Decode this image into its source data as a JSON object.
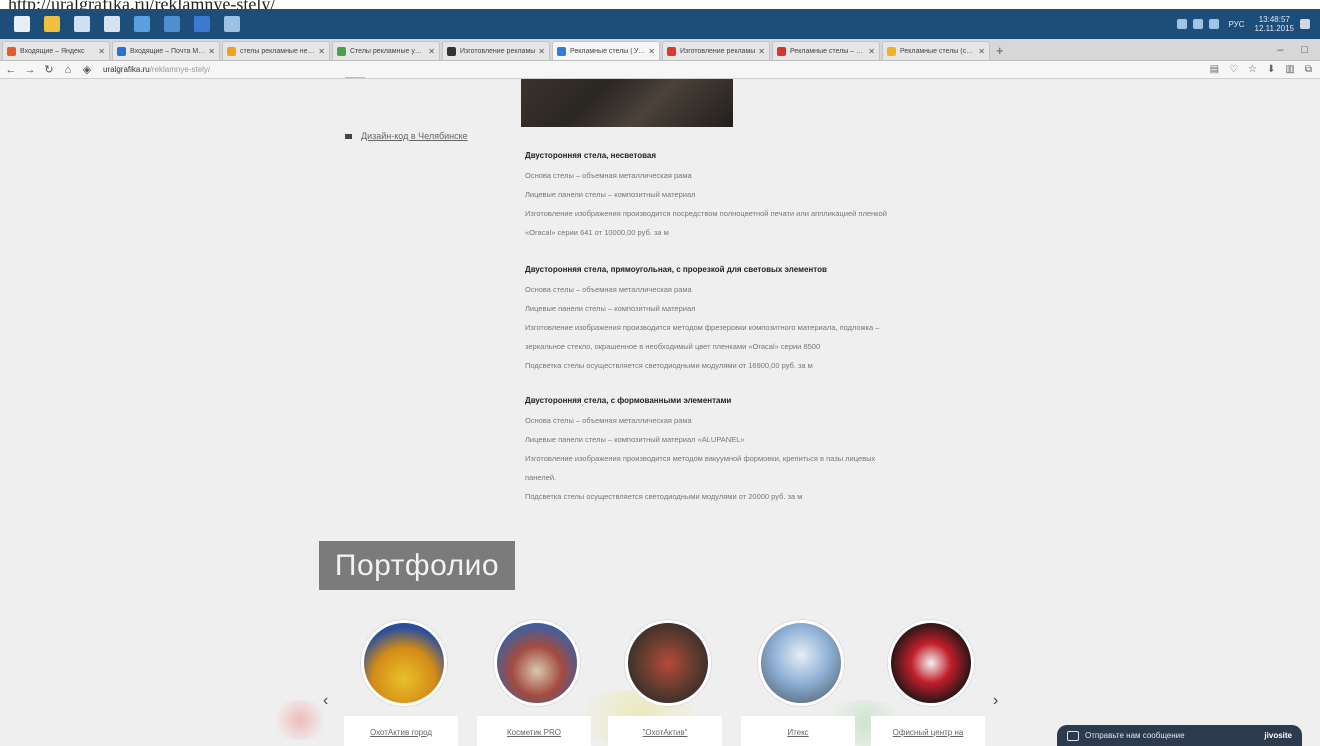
{
  "url_strip": {
    "text": "http://uralgrafika.ru/reklamnye-stely/"
  },
  "taskbar": {
    "clock_time": "13:48:57",
    "clock_date": "12.11.2015",
    "lang": "РУС"
  },
  "tabs": [
    {
      "label": "Входящие – Яндекс",
      "color": "#e55a2b"
    },
    {
      "label": "Входящие – Почта Mail.ru",
      "color": "#2a6fd1"
    },
    {
      "label": "стелы рекламные несветовые",
      "color": "#f1a21a"
    },
    {
      "label": "Стелы рекламные уличные",
      "color": "#4aa04a"
    },
    {
      "label": "Изготовление рекламы",
      "color": "#333333"
    },
    {
      "label": "Рекламные стелы | Уралграфика",
      "color": "#2b7fd8",
      "active": true
    },
    {
      "label": "Изготовление рекламы",
      "color": "#d93a2b"
    },
    {
      "label": "Рекламные стелы – Екатеринбург",
      "color": "#d9342b"
    },
    {
      "label": "Рекламные стелы (стелы)",
      "color": "#f2b41c"
    }
  ],
  "browser": {
    "url_domain": "uralgrafika.ru",
    "url_path": "/reklamnye-stely/"
  },
  "sidebar": {
    "link": "Дизайн-код в Челябинске"
  },
  "sections": [
    {
      "title": "Двусторонняя стела, несветовая",
      "lines": [
        "Основа стелы – объемная металлическая рама",
        "Лицевые панели стелы – композитный материал",
        "Изготовление изображения производится посредством полноцветной печати или аппликацией пленкой",
        "«Oracal» серии 641 от 10000,00 руб. за м"
      ]
    },
    {
      "title": "Двусторонняя стела, прямоугольная, с прорезкой для световых элементов",
      "lines": [
        "Основа стелы – объемная металлическая рама",
        "Лицевые панели стелы – композитный материал",
        "Изготовление изображения производится методом фрезеровки композитного материала, подложка –",
        "зеркальное стекло, окрашенное в необходимый цвет пленками «Oracal» серии 8500",
        "Подсветка стелы осуществляется светодиодными модулями от 16900,00 руб. за м"
      ]
    },
    {
      "title": "Двусторонняя стела, с формованными элементами",
      "lines": [
        "Основа стелы – объемная металлическая рама",
        "Лицевые панели стелы – композитный материал «ALUPANEL»",
        "Изготовление изображения производится методом вакуумной формовки, крепиться в пазы лицевых",
        "панелей.",
        "Подсветка стелы осуществляется светодиодными модулями от 20000 руб. за м"
      ]
    }
  ],
  "portfolio": {
    "title": "Портфолио",
    "items": [
      {
        "caption": "ОхотАктив город"
      },
      {
        "caption": "Косметик PRO"
      },
      {
        "caption": "\"ОхотАктив\""
      },
      {
        "caption": "Итекс"
      },
      {
        "caption": "Офисный центр на"
      }
    ]
  },
  "chat": {
    "prompt": "Отправьте нам сообщение",
    "brand": "jivosite"
  }
}
